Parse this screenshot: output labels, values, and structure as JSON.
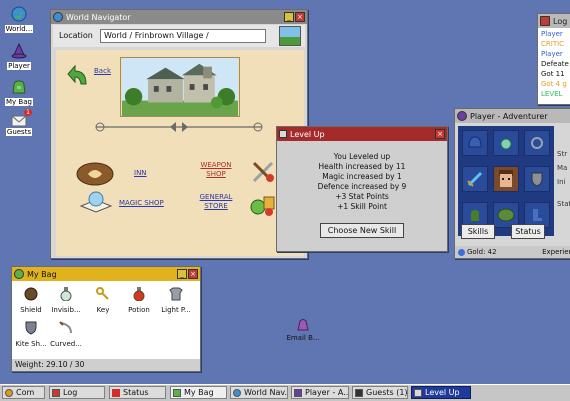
{
  "desktop": {
    "icons": [
      {
        "label": "World..."
      },
      {
        "label": "Player"
      },
      {
        "label": "My Bag"
      },
      {
        "label": "Guests",
        "badge": "1"
      }
    ],
    "floating_item": {
      "label": "Email B..."
    }
  },
  "world_nav": {
    "title": "World Navigator",
    "location_label": "Location",
    "location_value": "World / Frinbrown Village /",
    "back_label": "Back",
    "links": {
      "inn": "INN",
      "magic_shop": "MAGIC SHOP",
      "weapon_shop_1": "WEAPON",
      "weapon_shop_2": "SHOP",
      "general_store_1": "GENERAL",
      "general_store_2": "STORE"
    }
  },
  "level_up": {
    "title": "Level Up",
    "lines": [
      "You Leveled up",
      "Health increased by 11",
      "Magic increased by 1",
      "Defence increased by 9",
      "+3 Stat Points",
      "+1 Skill Point"
    ],
    "button": "Choose New Skill"
  },
  "log": {
    "title": "Log",
    "lines": [
      "Player",
      "CRITIC",
      "Player",
      "Defeate",
      "Got 11",
      "Got 4 g",
      "LEVEL"
    ]
  },
  "player": {
    "title": "Player - Adventurer",
    "skills_button": "Skills",
    "status_button": "Status",
    "gold": "Gold: 42",
    "experience": "Experien",
    "side_text": [
      "Str",
      "Ma",
      "Ini",
      "Stat"
    ]
  },
  "bag": {
    "title": "My Bag",
    "items": [
      {
        "label": "Shield",
        "icon": "shield-icon"
      },
      {
        "label": "Invisib...",
        "icon": "potion-bottle-icon"
      },
      {
        "label": "Key",
        "icon": "key-icon"
      },
      {
        "label": "Potion",
        "icon": "red-potion-icon"
      },
      {
        "label": "Light P...",
        "icon": "armor-icon"
      },
      {
        "label": "Kite Sh...",
        "icon": "kite-shield-icon"
      },
      {
        "label": "Curved...",
        "icon": "curved-sword-icon"
      }
    ],
    "weight": "Weight: 29.10 / 30"
  },
  "taskbar": {
    "items": [
      "Com",
      "Log",
      "Status",
      "My Bag",
      "World Nav...",
      "Player - A...",
      "Guests (1)",
      "Level Up"
    ]
  },
  "colors": {
    "desktop": "#5f76b3",
    "world_nav_titlebar": "#8a8a8a",
    "level_up_titlebar": "#a52b2b",
    "bag_titlebar": "#e0b21d",
    "player_titlebar": "#b9b9b9",
    "content_tan": "#f1dfb9"
  }
}
